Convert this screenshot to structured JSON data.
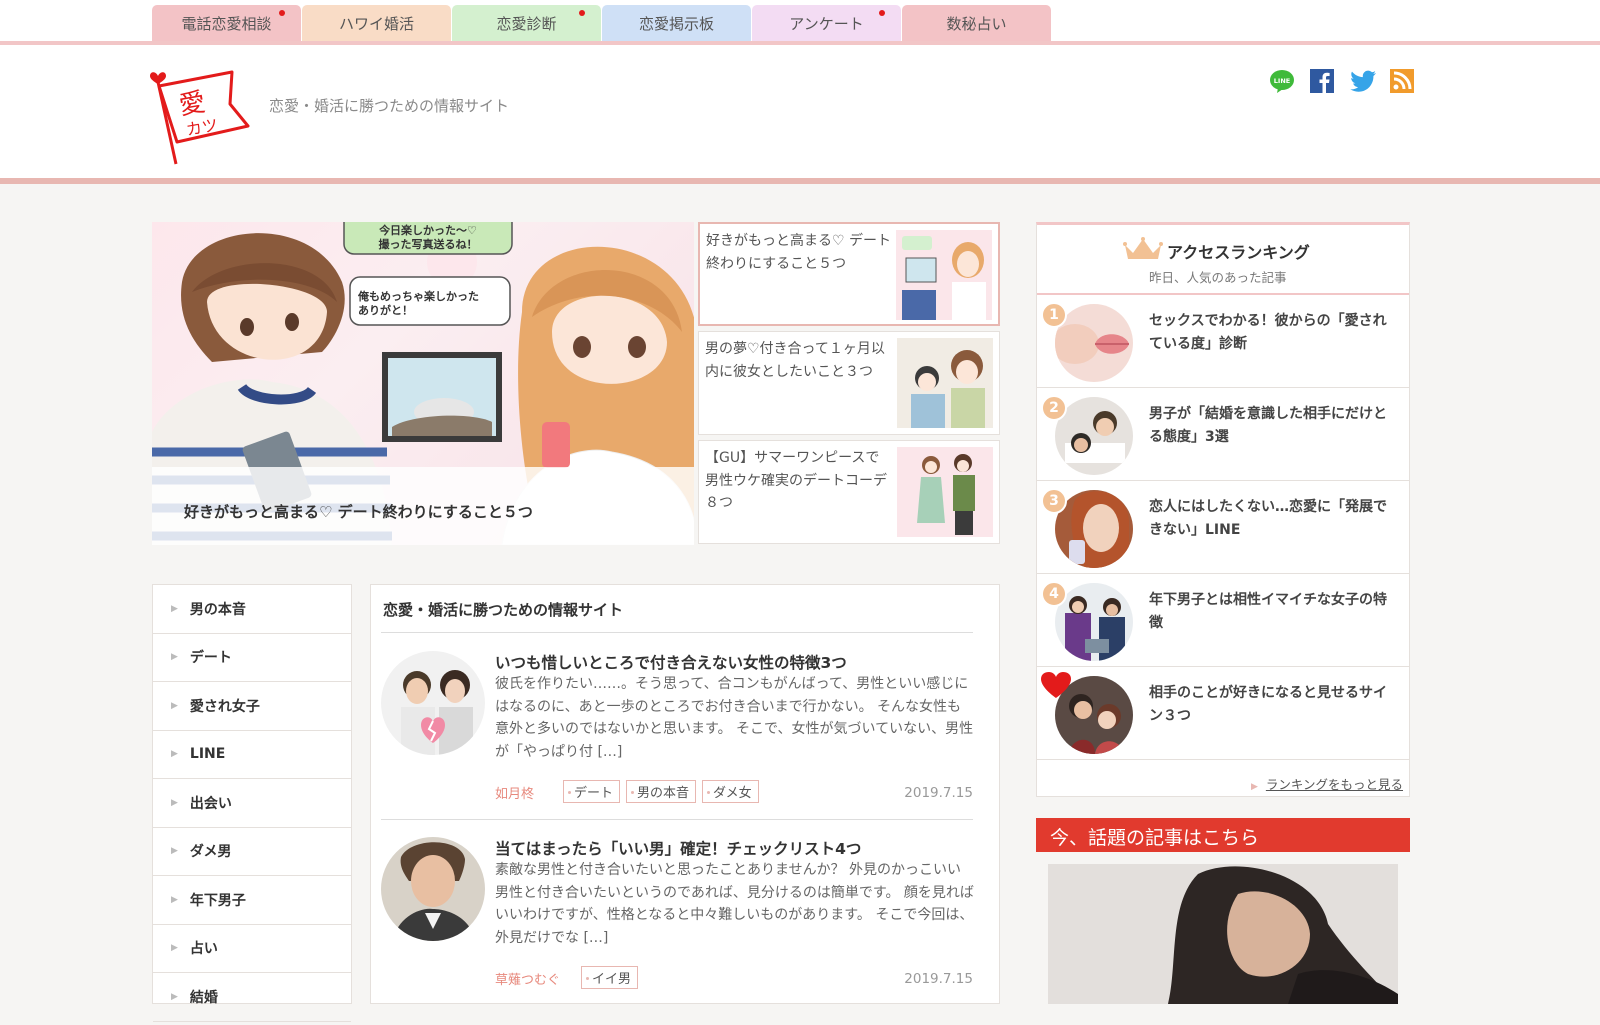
{
  "tabs": [
    {
      "label": "電話恋愛相談",
      "bg": "#f3c3c6",
      "dot": true
    },
    {
      "label": "ハワイ婚活",
      "bg": "#f9dcc6",
      "dot": false
    },
    {
      "label": "恋愛診断",
      "bg": "#d4f0cf",
      "dot": true
    },
    {
      "label": "恋愛掲示板",
      "bg": "#cfe0f6",
      "dot": false
    },
    {
      "label": "アンケート",
      "bg": "#f3dcf3",
      "dot": true
    },
    {
      "label": "数秘占い",
      "bg": "#f3c3c6",
      "dot": false
    }
  ],
  "header": {
    "logo_text": "愛カツ",
    "tagline": "恋愛・婚活に勝つための情報サイト"
  },
  "social": [
    "line-icon",
    "facebook-icon",
    "twitter-icon",
    "rss-icon"
  ],
  "feature": {
    "main_caption": "好きがもっと高まる♡ デート終わりにすること５つ",
    "speech1": "今日楽しかった～♡\n撮った写真送るね！",
    "speech2": "俺もめっちゃ楽しかった\nありがと！",
    "side": [
      {
        "title": "好きがもっと高まる♡ デート終わりにすること５つ"
      },
      {
        "title": "男の夢♡付き合って１ヶ月以内に彼女としたいこと３つ"
      },
      {
        "title": "【GU】サマーワンピースで男性ウケ確実のデートコーデ８つ"
      }
    ]
  },
  "nav": [
    "男の本音",
    "デート",
    "愛され女子",
    "LINE",
    "出会い",
    "ダメ男",
    "年下男子",
    "占い",
    "結婚"
  ],
  "articles": {
    "heading": "恋愛・婚活に勝つための情報サイト",
    "items": [
      {
        "title": "いつも惜しいところで付き合えない女性の特徴3つ",
        "excerpt": "彼氏を作りたい……。そう思って、合コンもがんばって、男性といい感じにはなるのに、あと一歩のところでお付き合いまで行かない。 そんな女性も意外と多いのではないかと思います。 そこで、女性が気づいていない、男性が「やっぱり付 […]",
        "author": "如月柊",
        "tags": [
          "デート",
          "男の本音",
          "ダメ女"
        ],
        "date": "2019.7.15"
      },
      {
        "title": "当てはまったら「いい男」確定！チェックリスト4つ",
        "excerpt": "素敵な男性と付き合いたいと思ったことありませんか？ 外見のかっこいい男性と付き合いたいというのであれば、見分けるのは簡単です。 顔を見ればいいわけですが、性格となると中々難しいものがあります。 そこで今回は、外見だけでな […]",
        "author": "草薙つむぐ",
        "tags": [
          "イイ男"
        ],
        "date": "2019.7.15"
      }
    ]
  },
  "ranking": {
    "title": "アクセスランキング",
    "subtitle": "昨日、人気のあった記事",
    "items": [
      {
        "num": "1",
        "title": "セックスでわかる！彼からの「愛されている度」診断"
      },
      {
        "num": "2",
        "title": "男子が「結婚を意識した相手にだけとる態度」3選"
      },
      {
        "num": "3",
        "title": "恋人にはしたくない…恋愛に「発展できない」LINE"
      },
      {
        "num": "4",
        "title": "年下男子とは相性イマイチな女子の特徴"
      },
      {
        "num": "",
        "title": "相手のことが好きになると見せるサイン３つ"
      }
    ],
    "more": "ランキングをもっと見る"
  },
  "hot": {
    "title": "今、話題の記事はこちら"
  }
}
